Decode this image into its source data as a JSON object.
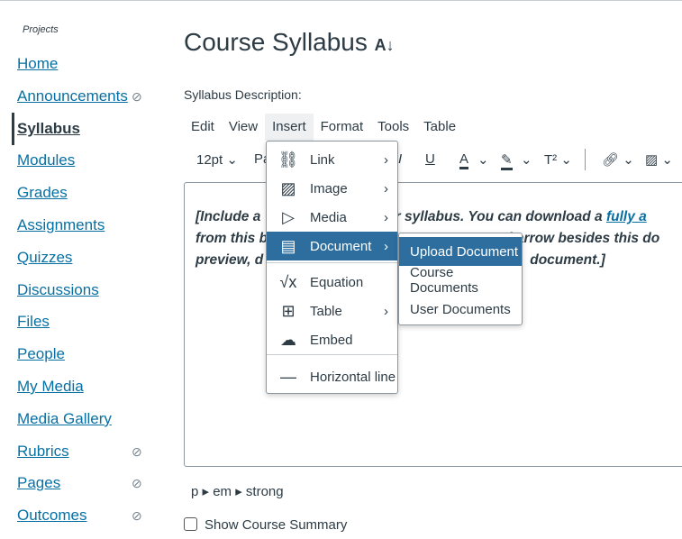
{
  "breadcrumb": "Projects",
  "nav": [
    {
      "label": "Home",
      "hidden": false
    },
    {
      "label": "Announcements",
      "hidden": true
    },
    {
      "label": "Syllabus",
      "hidden": false,
      "active": true
    },
    {
      "label": "Modules",
      "hidden": false
    },
    {
      "label": "Grades",
      "hidden": false
    },
    {
      "label": "Assignments",
      "hidden": false
    },
    {
      "label": "Quizzes",
      "hidden": false
    },
    {
      "label": "Discussions",
      "hidden": false
    },
    {
      "label": "Files",
      "hidden": false
    },
    {
      "label": "People",
      "hidden": false
    },
    {
      "label": "My Media",
      "hidden": false
    },
    {
      "label": "Media Gallery",
      "hidden": false
    },
    {
      "label": "Rubrics",
      "hidden": true
    },
    {
      "label": "Pages",
      "hidden": true
    },
    {
      "label": "Outcomes",
      "hidden": true
    }
  ],
  "title": "Course Syllabus",
  "description_label": "Syllabus Description:",
  "menubar": [
    "Edit",
    "View",
    "Insert",
    "Format",
    "Tools",
    "Table"
  ],
  "toolbar": {
    "font_size": "12pt",
    "paragraph": "Pa"
  },
  "editor": {
    "line1a": "[Include a ",
    "line1b": "f your syllabus. You can download a ",
    "link": "fully a",
    "line2a": "from this b",
    "line2b": "rd arrow besides this do",
    "line3a": "preview, d",
    "line3b": "document.]"
  },
  "insert_menu": [
    {
      "label": "Link",
      "icon": "link-icon",
      "submenu": true
    },
    {
      "label": "Image",
      "icon": "image-icon",
      "submenu": true
    },
    {
      "label": "Media",
      "icon": "media-icon",
      "submenu": true
    },
    {
      "label": "Document",
      "icon": "document-icon",
      "submenu": true,
      "highlighted": true
    },
    {
      "label": "Equation",
      "icon": "equation-icon",
      "submenu": false
    },
    {
      "label": "Table",
      "icon": "table-icon",
      "submenu": true
    },
    {
      "label": "Embed",
      "icon": "embed-icon",
      "submenu": false
    },
    {
      "label": "Horizontal line",
      "icon": "horizontal-line-icon",
      "submenu": false
    }
  ],
  "document_submenu": [
    "Upload Document",
    "Course Documents",
    "User Documents"
  ],
  "status_path": "p ▸ em ▸ strong",
  "show_summary": "Show Course Summary",
  "colors": {
    "link": "#0770a3",
    "highlight": "#2d6e9e"
  }
}
